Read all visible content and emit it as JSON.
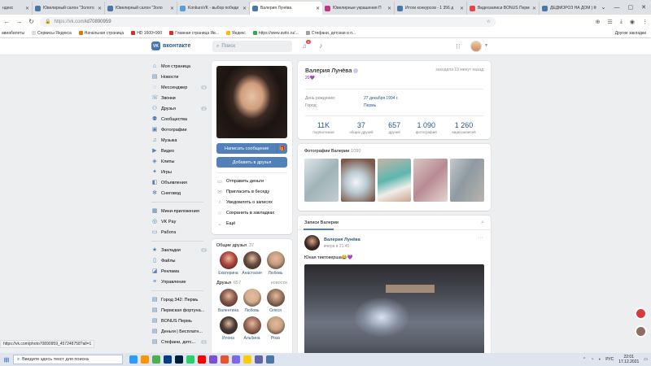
{
  "browser": {
    "tabs": [
      {
        "title": "ндекс",
        "color": "#ffcc00"
      },
      {
        "title": "Ювелирный салон \"Золото",
        "color": "#4a76a8"
      },
      {
        "title": "Ювелирный салон \"Золо",
        "color": "#4a76a8"
      },
      {
        "title": "KonkursVK - выбор победи",
        "color": "#5c9bd6"
      },
      {
        "title": "Валерия Лунёва",
        "color": "#4a76a8",
        "active": true
      },
      {
        "title": "Ювелирные украшения П",
        "color": "#c13584"
      },
      {
        "title": "Итоги конкурсов - 1 356 д",
        "color": "#4a76a8"
      },
      {
        "title": "Видеозаписи BONUS Пермь К",
        "color": "#e64646"
      },
      {
        "title": "ДЕДМОРОЗ НА ДОМ | КОН",
        "color": "#4a76a8"
      }
    ],
    "url_host": "https://vk.com",
    "url_path": "/id70890959",
    "bookmarks": [
      {
        "label": "авиабилеты",
        "color": "#8ab4f8"
      },
      {
        "label": "Сервисы Яндекса",
        "color": "#dadce0"
      },
      {
        "label": "Начальная страница",
        "color": "#e37400"
      },
      {
        "label": "HD 1600×900",
        "color": "#d93025"
      },
      {
        "label": "Главная страница Яв...",
        "color": "#d93025"
      },
      {
        "label": "Яндекс",
        "color": "#fbbc04"
      },
      {
        "label": "https://www.avito.ru/...",
        "color": "#34a853"
      },
      {
        "label": "Стефани, детская и п...",
        "color": "#9aa0a6"
      }
    ],
    "other_bookmarks": "Другие закладки"
  },
  "vk": {
    "logo_text": "вконтакте",
    "search_placeholder": "Поиск",
    "notif_count": "5",
    "nav": [
      {
        "label": "Моя страница",
        "icon": "home-icon",
        "glyph": "⌂"
      },
      {
        "label": "Новости",
        "icon": "news-icon",
        "glyph": "▤"
      },
      {
        "label": "Мессенджер",
        "icon": "message-icon",
        "glyph": "◌",
        "count": "9"
      },
      {
        "label": "Звонки",
        "icon": "phone-icon",
        "glyph": "☏"
      },
      {
        "label": "Друзья",
        "icon": "friends-icon",
        "glyph": "⚇",
        "count": "1"
      },
      {
        "label": "Сообщества",
        "icon": "groups-icon",
        "glyph": "⚉"
      },
      {
        "label": "Фотографии",
        "icon": "photo-icon",
        "glyph": "▣"
      },
      {
        "label": "Музыка",
        "icon": "music-icon",
        "glyph": "♫"
      },
      {
        "label": "Видео",
        "icon": "video-icon",
        "glyph": "▶"
      },
      {
        "label": "Клипы",
        "icon": "clips-icon",
        "glyph": "◈"
      },
      {
        "label": "Игры",
        "icon": "games-icon",
        "glyph": "✦"
      },
      {
        "label": "Объявления",
        "icon": "ads-icon",
        "glyph": "◧"
      },
      {
        "label": "Снеговод",
        "icon": "snowflake-icon",
        "glyph": "✻"
      }
    ],
    "nav2": [
      {
        "label": "Мини-приложения",
        "icon": "apps-icon",
        "glyph": "▦"
      },
      {
        "label": "VK Pay",
        "icon": "pay-icon",
        "glyph": "◎"
      },
      {
        "label": "Работа",
        "icon": "work-icon",
        "glyph": "▭"
      }
    ],
    "nav3": [
      {
        "label": "Закладки",
        "icon": "bookmark-icon",
        "glyph": "★",
        "count": "1"
      },
      {
        "label": "Файлы",
        "icon": "files-icon",
        "glyph": "▯"
      },
      {
        "label": "Реклама",
        "icon": "adv-icon",
        "glyph": "◪"
      },
      {
        "label": "Управление",
        "icon": "manage-icon",
        "glyph": "≡"
      }
    ],
    "nav4": [
      {
        "label": "Город 342: Пермь",
        "icon": "group-icon",
        "glyph": "▤"
      },
      {
        "label": "Пермская фортуна...",
        "icon": "group-icon",
        "glyph": "▤"
      },
      {
        "label": "BONUS Пермь",
        "icon": "group-icon",
        "glyph": "▤"
      },
      {
        "label": "Деньги | Бесплатн...",
        "icon": "group-icon",
        "glyph": "▤"
      },
      {
        "label": "Стефани, детс...",
        "icon": "group-icon",
        "glyph": "▤",
        "count": "1"
      }
    ],
    "profile_buttons": {
      "message": "Написать сообщение",
      "add_friend": "Добавить в друзья"
    },
    "actions": [
      {
        "label": "Отправить деньги",
        "icon": "money-icon",
        "glyph": "▭"
      },
      {
        "label": "Пригласить в беседу",
        "icon": "invite-icon",
        "glyph": "✉"
      },
      {
        "label": "Уведомлять о записях",
        "icon": "bell-icon",
        "glyph": "♪"
      },
      {
        "label": "Сохранить в закладках",
        "icon": "star-icon",
        "glyph": "☆"
      },
      {
        "label": "Ещё",
        "icon": "chevron-down-icon",
        "glyph": "⌄"
      }
    ],
    "common_friends": {
      "title": "Общие друзья",
      "count": "37",
      "people": [
        {
          "name": "Екатерина",
          "color": "#b0463f"
        },
        {
          "name": "Анастасия",
          "color": "#6a4e42"
        },
        {
          "name": "Любовь",
          "color": "#c59b7c"
        }
      ]
    },
    "friends": {
      "title": "Друзья",
      "count": "657",
      "more": "новости",
      "row1": [
        {
          "name": "Валентина",
          "color": "#8c5a4d"
        },
        {
          "name": "Любовь",
          "color": "#d5b08f"
        },
        {
          "name": "Олеся",
          "color": "#9a7660"
        }
      ],
      "row2": [
        {
          "name": "Илона",
          "color": "#4a3b37"
        },
        {
          "name": "Альбина",
          "color": "#9b6a57"
        },
        {
          "name": "Роза",
          "color": "#c9a27f"
        }
      ]
    },
    "profile": {
      "name": "Валерия Лунёва",
      "status": "20💜",
      "online": "заходила 19 минут назад",
      "birthday_label": "День рождения:",
      "birthday": "27 декабря 1994 г.",
      "city_label": "Город:",
      "city": "Пермь",
      "stats": [
        {
          "num": "11K",
          "label": "подписчиков"
        },
        {
          "num": "37",
          "label": "общих друзей"
        },
        {
          "num": "657",
          "label": "друзей"
        },
        {
          "num": "1 090",
          "label": "фотографий"
        },
        {
          "num": "1 260",
          "label": "видеозаписей"
        }
      ]
    },
    "photos": {
      "title": "Фотографии Валерии",
      "count": "1090",
      "thumbs": [
        {
          "name": "photo-thumb-1",
          "bg": "linear-gradient(135deg,#dfe6e8,#9fb3b8 50%,#c4ced0)"
        },
        {
          "name": "photo-thumb-2",
          "bg": "radial-gradient(circle at 45% 55%,#f2f6f8 0%,#b9cad0 35%,#7f5a4b 80%)"
        },
        {
          "name": "photo-thumb-3",
          "bg": "linear-gradient(160deg,#c7b4a6,#5db6b0 45%,#f0ede8 70%,#c9a58f)"
        },
        {
          "name": "photo-thumb-4",
          "bg": "linear-gradient(135deg,#d9c9c2,#b88a93 50%,#e4d6d0)"
        },
        {
          "name": "photo-thumb-5",
          "bg": "linear-gradient(120deg,#c5c9cc,#8e9aa1 45%,#b9b3ad)"
        }
      ]
    },
    "posts": {
      "tab": "Записи Валерии",
      "author": "Валерия Лунёва",
      "time": "вчера в 21:45",
      "text": "Юная тиктокерша😂💜"
    }
  },
  "statusbar_url": "https://vk.com/photo70890959_457248758?all=1",
  "taskbar": {
    "search_placeholder": "Введите здесь текст для поиска",
    "lang": "РУС",
    "time": "22:01",
    "date": "17.12.2021",
    "apps": [
      "#2b9bff",
      "#ff9500",
      "#4caf50",
      "#003e8a",
      "#001e36",
      "#25d366",
      "#ff0000",
      "#7b4fd6",
      "#e8552c",
      "#7b68ee",
      "#ffcc00",
      "#6264a7",
      "#4a76a8"
    ]
  }
}
